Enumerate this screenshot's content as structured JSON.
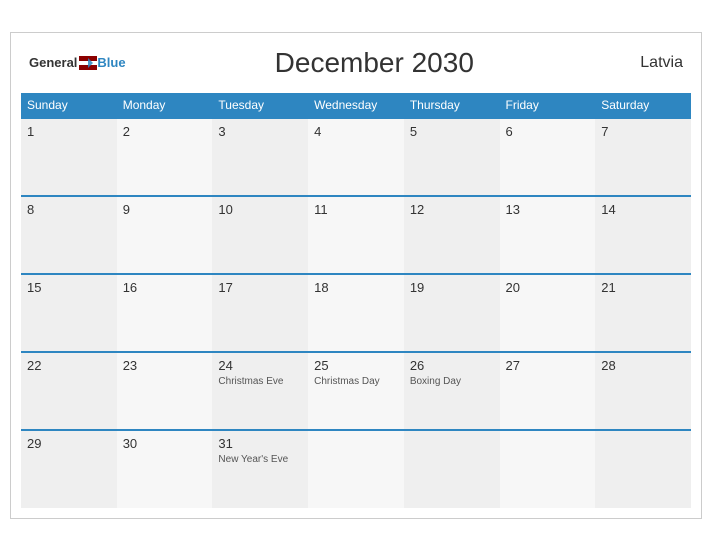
{
  "header": {
    "logo_general": "General",
    "logo_blue": "Blue",
    "title": "December 2030",
    "country": "Latvia"
  },
  "weekdays": [
    "Sunday",
    "Monday",
    "Tuesday",
    "Wednesday",
    "Thursday",
    "Friday",
    "Saturday"
  ],
  "weeks": [
    [
      {
        "day": "1",
        "holiday": ""
      },
      {
        "day": "2",
        "holiday": ""
      },
      {
        "day": "3",
        "holiday": ""
      },
      {
        "day": "4",
        "holiday": ""
      },
      {
        "day": "5",
        "holiday": ""
      },
      {
        "day": "6",
        "holiday": ""
      },
      {
        "day": "7",
        "holiday": ""
      }
    ],
    [
      {
        "day": "8",
        "holiday": ""
      },
      {
        "day": "9",
        "holiday": ""
      },
      {
        "day": "10",
        "holiday": ""
      },
      {
        "day": "11",
        "holiday": ""
      },
      {
        "day": "12",
        "holiday": ""
      },
      {
        "day": "13",
        "holiday": ""
      },
      {
        "day": "14",
        "holiday": ""
      }
    ],
    [
      {
        "day": "15",
        "holiday": ""
      },
      {
        "day": "16",
        "holiday": ""
      },
      {
        "day": "17",
        "holiday": ""
      },
      {
        "day": "18",
        "holiday": ""
      },
      {
        "day": "19",
        "holiday": ""
      },
      {
        "day": "20",
        "holiday": ""
      },
      {
        "day": "21",
        "holiday": ""
      }
    ],
    [
      {
        "day": "22",
        "holiday": ""
      },
      {
        "day": "23",
        "holiday": ""
      },
      {
        "day": "24",
        "holiday": "Christmas Eve"
      },
      {
        "day": "25",
        "holiday": "Christmas Day"
      },
      {
        "day": "26",
        "holiday": "Boxing Day"
      },
      {
        "day": "27",
        "holiday": ""
      },
      {
        "day": "28",
        "holiday": ""
      }
    ],
    [
      {
        "day": "29",
        "holiday": ""
      },
      {
        "day": "30",
        "holiday": ""
      },
      {
        "day": "31",
        "holiday": "New Year's Eve"
      },
      {
        "day": "",
        "holiday": ""
      },
      {
        "day": "",
        "holiday": ""
      },
      {
        "day": "",
        "holiday": ""
      },
      {
        "day": "",
        "holiday": ""
      }
    ]
  ]
}
